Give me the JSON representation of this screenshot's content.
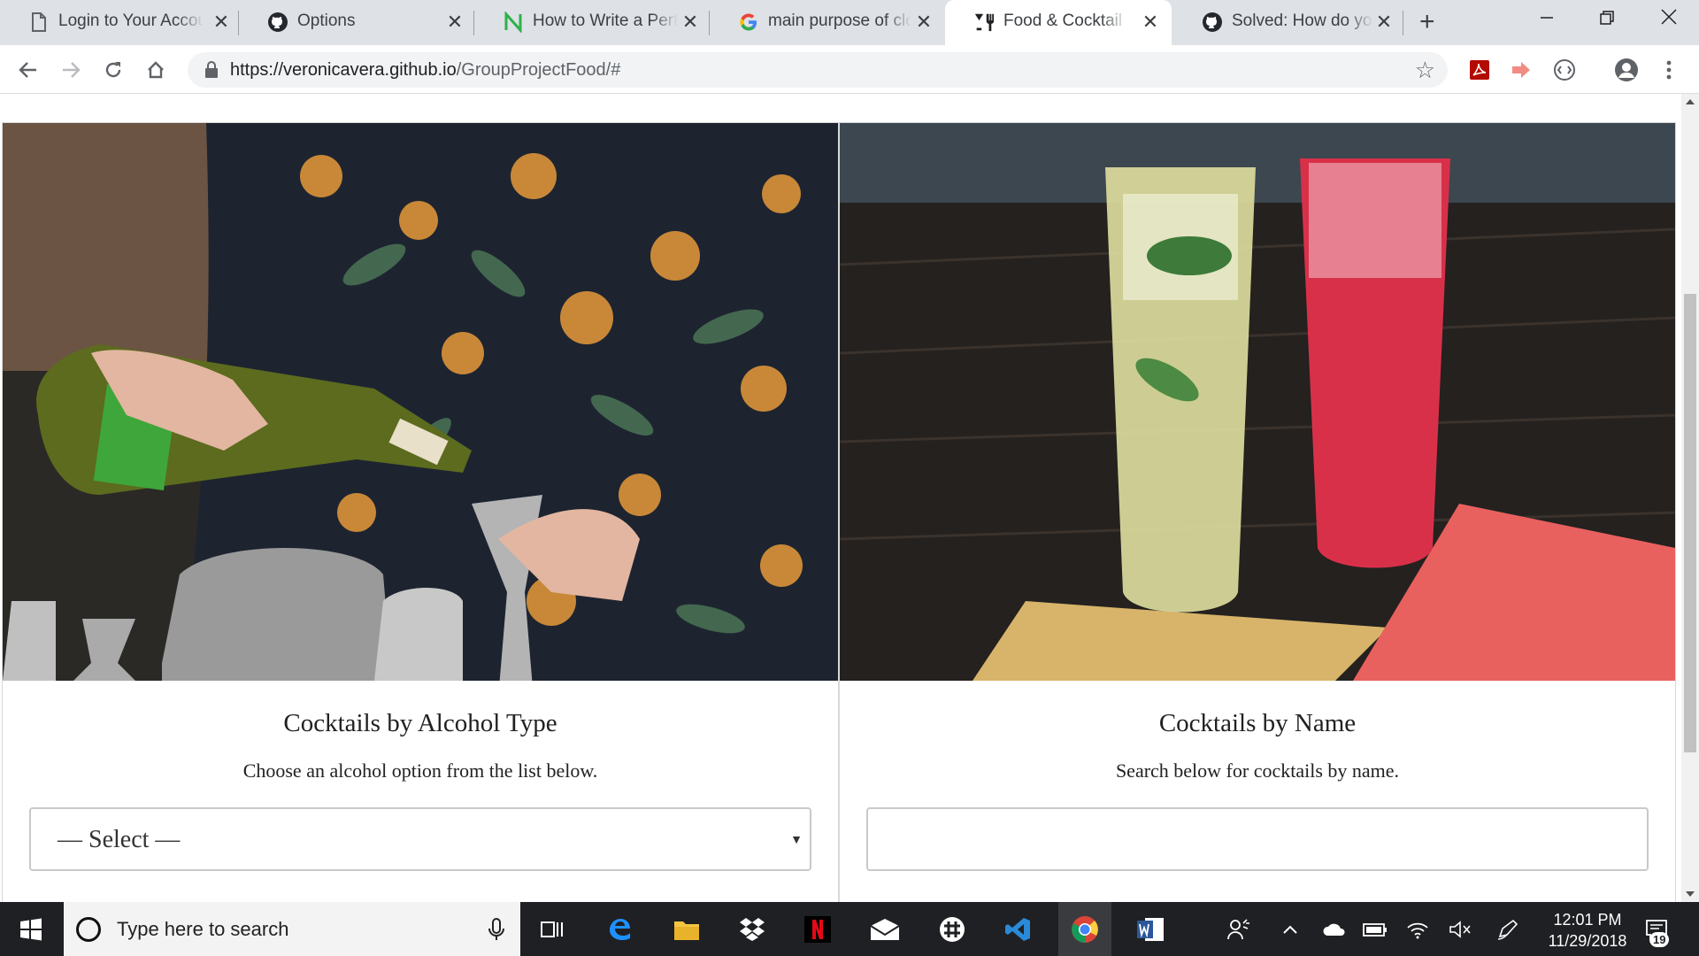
{
  "browser": {
    "tabs": [
      {
        "title": "Login to Your Account",
        "favicon": "document-icon",
        "active": false
      },
      {
        "title": "Options",
        "favicon": "github-icon",
        "active": false
      },
      {
        "title": "How to Write a Perfect",
        "favicon": "n-logo-icon",
        "active": false
      },
      {
        "title": "main purpose of cloud",
        "favicon": "google-icon",
        "active": false
      },
      {
        "title": "Food & Cocktail",
        "favicon": "food-cocktail-icon",
        "active": true
      },
      {
        "title": "Solved: How do you",
        "favicon": "github-icon",
        "active": false
      }
    ],
    "url": {
      "host": "https://veronicavera.github.io",
      "path": "/GroupProjectFood/#"
    }
  },
  "page": {
    "alcohol_card": {
      "heading": "Cocktails by Alcohol Type",
      "description": "Choose an alcohol option from the list below.",
      "select_value": "— Select —",
      "photo_alt": "Bartender pouring liqueur into a jigger"
    },
    "name_card": {
      "heading": "Cocktails by Name",
      "description": "Search below for cocktails by name.",
      "search_value": "",
      "photo_alt": "Two tall cocktails on a bar"
    }
  },
  "taskbar": {
    "search_placeholder": "Type here to search",
    "time": "12:01 PM",
    "date": "11/29/2018",
    "notification_count": "19"
  }
}
